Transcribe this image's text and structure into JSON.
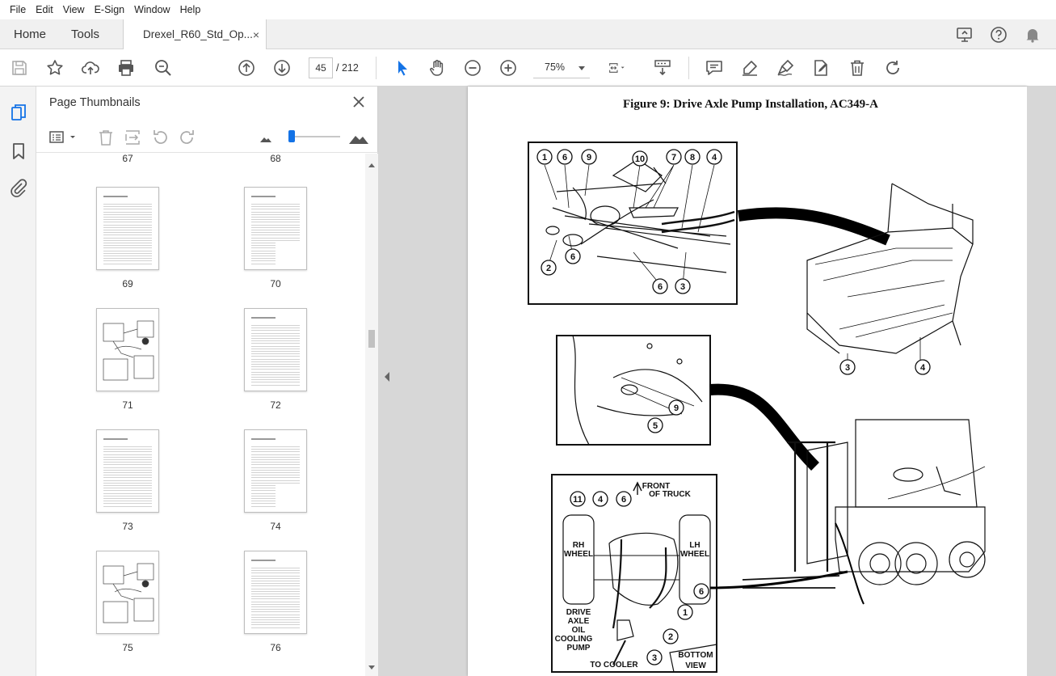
{
  "menu": [
    "File",
    "Edit",
    "View",
    "E-Sign",
    "Window",
    "Help"
  ],
  "tabs": {
    "home": "Home",
    "tools": "Tools",
    "document": "Drexel_R60_Std_Op...",
    "close": "×"
  },
  "toolbar": {
    "page_current": "45",
    "page_sep": "/",
    "page_total": "212",
    "zoom": "75%"
  },
  "panel": {
    "title": "Page Thumbnails",
    "thumbnails": [
      {
        "label": "67",
        "type": "partial"
      },
      {
        "label": "68",
        "type": "partial"
      },
      {
        "label": "69",
        "type": "text"
      },
      {
        "label": "70",
        "type": "table"
      },
      {
        "label": "71",
        "type": "figure"
      },
      {
        "label": "72",
        "type": "text"
      },
      {
        "label": "73",
        "type": "text"
      },
      {
        "label": "74",
        "type": "table"
      },
      {
        "label": "75",
        "type": "figure"
      },
      {
        "label": "76",
        "type": "text"
      }
    ]
  },
  "document": {
    "figure_title": "Figure 9: Drive Axle Pump Installation, AC349-A",
    "callouts_top": [
      "1",
      "6",
      "9",
      "10",
      "7",
      "8",
      "4",
      "2",
      "6",
      "6",
      "3"
    ],
    "callouts_truck": [
      "3",
      "4"
    ],
    "callouts_mid": [
      "9",
      "5"
    ],
    "callouts_bottom": [
      "11",
      "4",
      "6",
      "6",
      "1",
      "2",
      "3"
    ],
    "labels": {
      "front": "FRONT",
      "of_truck": "OF TRUCK",
      "rh": "RH",
      "rh_wheel": "WHEEL",
      "lh": "LH",
      "lh_wheel": "WHEEL",
      "drive": "DRIVE",
      "axle": "AXLE",
      "oil": "OIL",
      "cooling": "COOLING",
      "pump": "PUMP",
      "to_cooler": "TO COOLER",
      "bottom": "BOTTOM",
      "view": "VIEW"
    }
  },
  "colors": {
    "accent": "#1473e6",
    "toolbar_bg": "#ffffff",
    "tabbar_bg": "#f0f0f0",
    "viewport_bg": "#d7d7d7"
  }
}
